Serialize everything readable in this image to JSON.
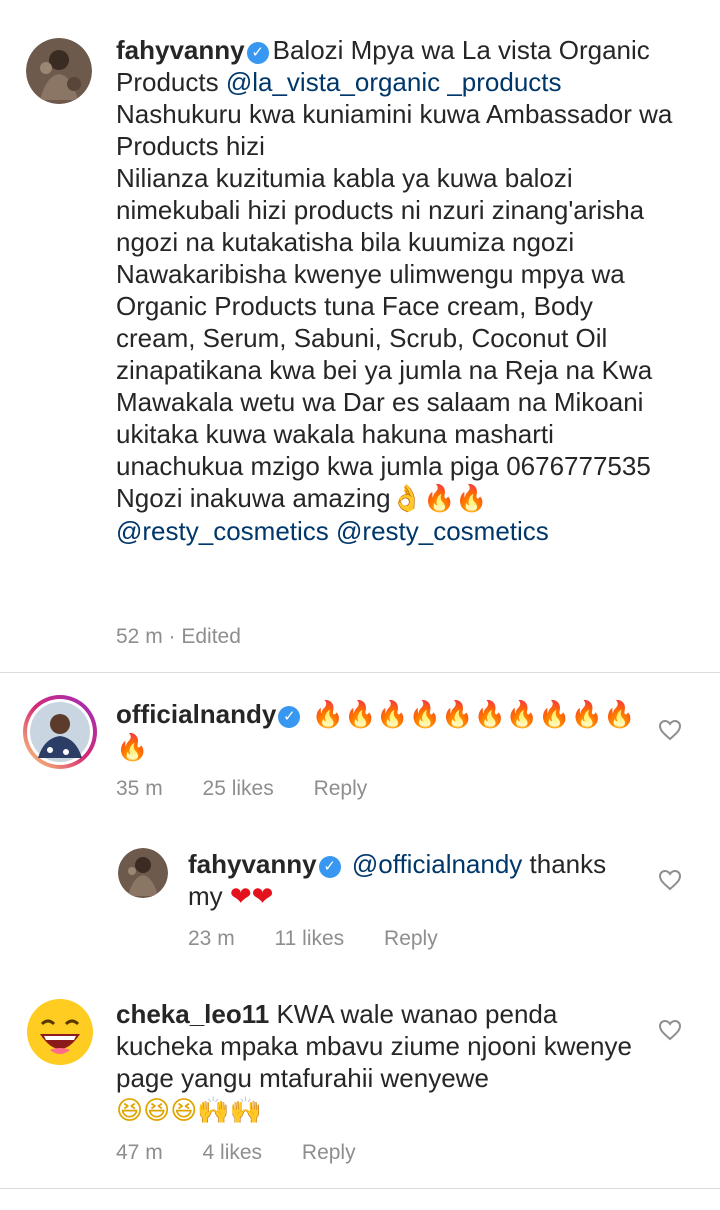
{
  "post": {
    "username": "fahyvanny",
    "caption_line1": "Balozi Mpya wa La vista Organic Products",
    "caption_mention1": "@la_vista_organic _products",
    "caption_body": "Nashukuru kwa kuniamini kuwa Ambassador wa Products hizi\nNilianza kuzitumia kabla ya kuwa balozi nimekubali hizi products ni nzuri zinang'arisha ngozi na kutakatisha bila kuumiza ngozi Nawakaribisha kwenye ulimwengu mpya wa Organic Products tuna Face cream, Body cream, Serum, Sabuni, Scrub, Coconut Oil zinapatikana kwa bei ya jumla na Reja na Kwa Mawakala wetu wa Dar es salaam na Mikoani ukitaka kuwa wakala hakuna masharti unachukua mzigo kwa jumla piga 0676777535 Ngozi inakuwa amazing",
    "caption_emojis": "👌🔥🔥",
    "caption_mention2": "@resty_cosmetics",
    "caption_mention3": "@resty_cosmetics",
    "time": "52 m · Edited"
  },
  "comments": [
    {
      "username": "officialnandy",
      "emojis": "🔥🔥🔥🔥🔥🔥🔥🔥🔥🔥🔥",
      "time": "35 m",
      "likes": "25 likes",
      "reply": "Reply"
    },
    {
      "username": "fahyvanny",
      "mention": "@officialnandy",
      "text": " thanks my ",
      "emojis": "❤❤",
      "time": "23 m",
      "likes": "11 likes",
      "reply": "Reply"
    },
    {
      "username": "cheka_leo11",
      "text": "KWA wale wanao penda kucheka mpaka mbavu ziume njooni kwenye page yangu mtafurahii wenyewe",
      "emojis1": "😆😆😆",
      "emojis2": "🙌🙌",
      "time": "47 m",
      "likes": "4 likes",
      "reply": "Reply"
    }
  ],
  "colors": {
    "mention": "#00376b",
    "meta": "#8e8e8e",
    "verified": "#3897f0"
  }
}
